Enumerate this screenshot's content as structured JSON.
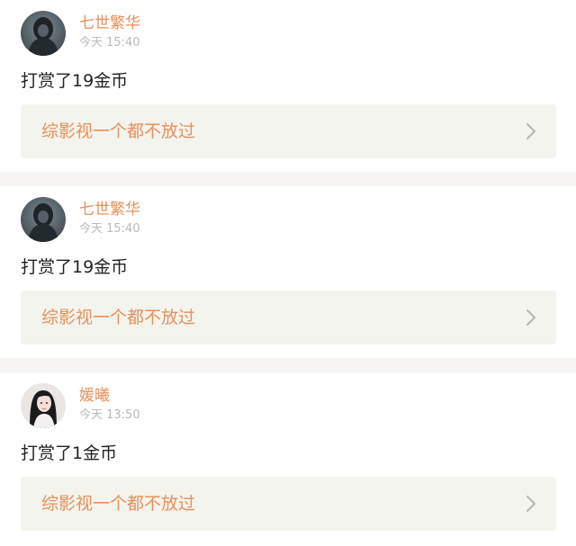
{
  "colors": {
    "accent": "#e8905a",
    "muted": "#b9b9b9",
    "card_link_bg": "#f4f4ee",
    "separator": "#f7f5f3"
  },
  "feed": [
    {
      "user": "七世繁华",
      "time": "今天 15:40",
      "message": "打赏了19金币",
      "book": "综影视一个都不放过",
      "avatar_icon": "dark-portrait-avatar",
      "link_icon": "chevron-right-icon"
    },
    {
      "user": "七世繁华",
      "time": "今天 15:40",
      "message": "打赏了19金币",
      "book": "综影视一个都不放过",
      "avatar_icon": "dark-portrait-avatar",
      "link_icon": "chevron-right-icon"
    },
    {
      "user": "媛曦",
      "time": "今天 13:50",
      "message": "打赏了1金币",
      "book": "综影视一个都不放过",
      "avatar_icon": "girl-portrait-avatar",
      "link_icon": "chevron-right-icon"
    }
  ]
}
